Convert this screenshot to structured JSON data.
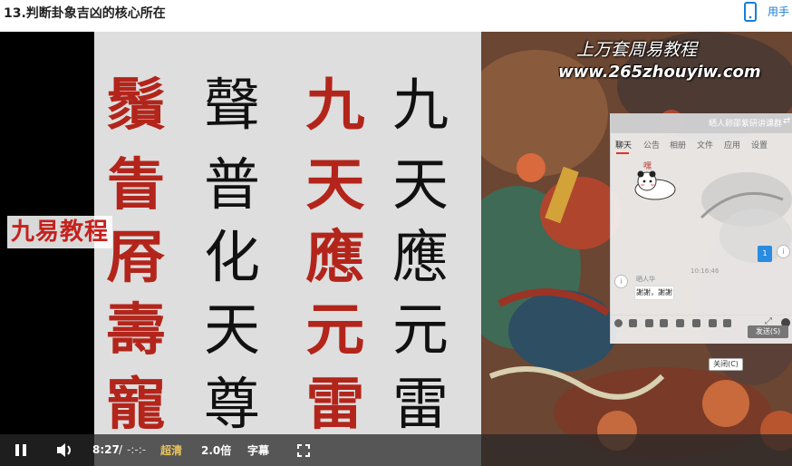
{
  "page": {
    "title": "13.判断卦象吉凶的核心所在",
    "phone_link": "用手"
  },
  "video": {
    "watermark_left": "九易教程",
    "site_title": "上万套周易教程",
    "site_url": "www.265zhouyiw.com",
    "calligraphy": {
      "col1": [
        "鬚",
        "眚",
        "㞕",
        "壽",
        "寵"
      ],
      "col2": [
        "聲",
        "普",
        "化",
        "天",
        "尊"
      ],
      "col3": [
        "九",
        "天",
        "應",
        "元",
        "雷"
      ],
      "col4": [
        "九",
        "天",
        "應",
        "元",
        "雷"
      ]
    }
  },
  "chat": {
    "header_title": "晒人卵邵紫研讲课群",
    "header_close": "⇄",
    "tabs": [
      "聊天",
      "公告",
      "相册",
      "文件",
      "应用",
      "设置"
    ],
    "emoji_caption": "嘿",
    "blue_message": "1",
    "time": "10:16:46",
    "sender": "晒人华",
    "bubble_text": "謝謝，謝謝",
    "close_button": "关闭(C)",
    "send_button": "发送(S)"
  },
  "controls": {
    "current_time": "8:27",
    "separator": "/",
    "total_time": "-:-:-",
    "quality": "超清",
    "speed": "2.0倍",
    "subtitle": "字幕"
  },
  "colors": {
    "accent_link": "#1a7cd8",
    "seal_red": "#b3251b",
    "quality_gold": "#e9c45c"
  }
}
